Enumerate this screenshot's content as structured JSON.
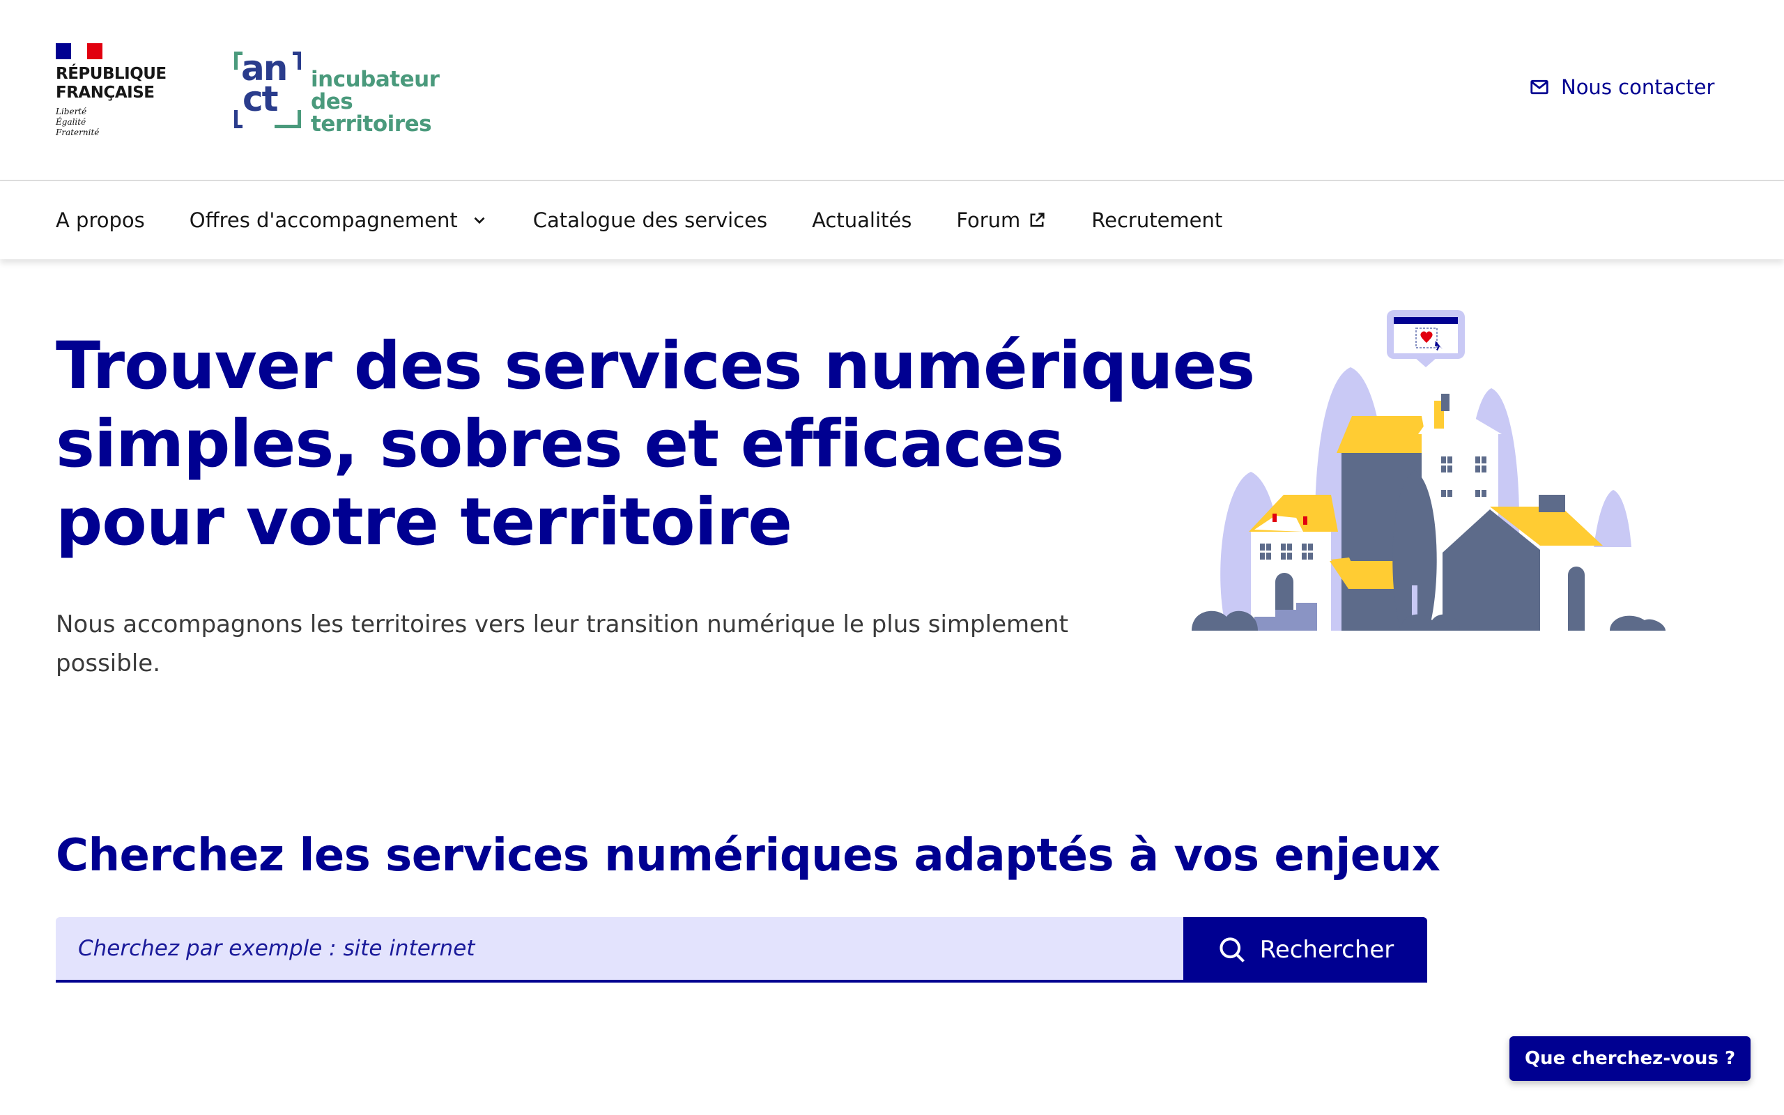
{
  "header": {
    "republic_line1": "RÉPUBLIQUE",
    "republic_line2": "FRANÇAISE",
    "motto_1": "Liberté",
    "motto_2": "Égalité",
    "motto_3": "Fraternité",
    "anct_logo_line1": "an",
    "anct_logo_line2": "ct",
    "anct_sub_line1": "incubateur",
    "anct_sub_line2": "des territoires",
    "contact_label": "Nous contacter",
    "contact_icon": "mail-icon"
  },
  "nav": {
    "items": [
      {
        "label": "A propos"
      },
      {
        "label": "Offres d'accompagnement",
        "icon": "chevron-down-icon"
      },
      {
        "label": "Catalogue des services"
      },
      {
        "label": "Actualités"
      },
      {
        "label": "Forum",
        "icon": "external-link-icon"
      },
      {
        "label": "Recrutement"
      }
    ]
  },
  "hero": {
    "title_line1": "Trouver des services numériques",
    "title_line2": "simples, sobres et efficaces",
    "title_line3": "pour votre territoire",
    "subtitle": "Nous accompagnons les territoires vers leur transition numérique le plus simplement possible."
  },
  "search": {
    "title": "Cherchez les services numériques adaptés à vos enjeux",
    "placeholder": "Cherchez par exemple : site internet",
    "button_label": "Rechercher",
    "button_icon": "search-icon"
  },
  "floating": {
    "label": "Que cherchez-vous ?"
  },
  "colors": {
    "primary_blue": "#000091",
    "input_background": "#e3e3fd",
    "anct_green": "#4a9a7c",
    "anct_blue": "#2a3c8c",
    "illustration_slate": "#5d6b8a",
    "illustration_yellow": "#ffcc33",
    "illustration_lavender": "#c9c9f5"
  }
}
